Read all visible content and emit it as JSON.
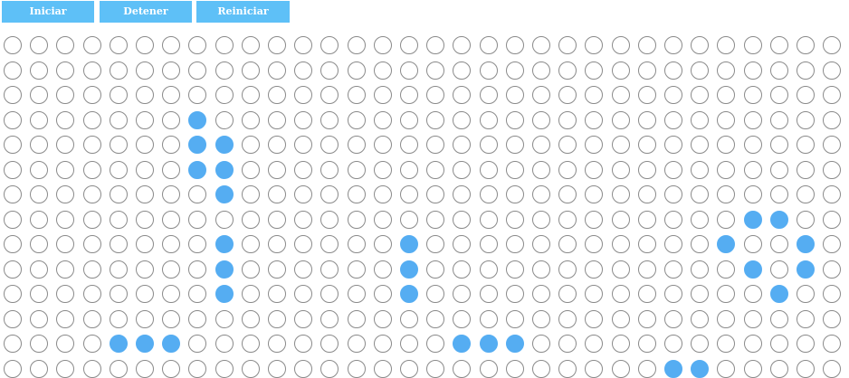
{
  "controls": {
    "start_label": "Iniciar",
    "stop_label": "Detener",
    "reset_label": "Reiniciar"
  },
  "board": {
    "columns": 32,
    "rows_visible": 14,
    "alive_color": "#55adf2",
    "dead_color": "#ffffff",
    "alive_cells": [
      [
        3,
        7
      ],
      [
        4,
        7
      ],
      [
        4,
        8
      ],
      [
        5,
        7
      ],
      [
        5,
        8
      ],
      [
        6,
        8
      ],
      [
        7,
        28
      ],
      [
        7,
        29
      ],
      [
        8,
        8
      ],
      [
        8,
        15
      ],
      [
        8,
        27
      ],
      [
        8,
        30
      ],
      [
        9,
        8
      ],
      [
        9,
        15
      ],
      [
        9,
        28
      ],
      [
        9,
        30
      ],
      [
        10,
        8
      ],
      [
        10,
        15
      ],
      [
        10,
        29
      ],
      [
        12,
        4
      ],
      [
        12,
        5
      ],
      [
        12,
        6
      ],
      [
        12,
        17
      ],
      [
        12,
        18
      ],
      [
        12,
        19
      ],
      [
        13,
        25
      ],
      [
        13,
        26
      ]
    ]
  }
}
